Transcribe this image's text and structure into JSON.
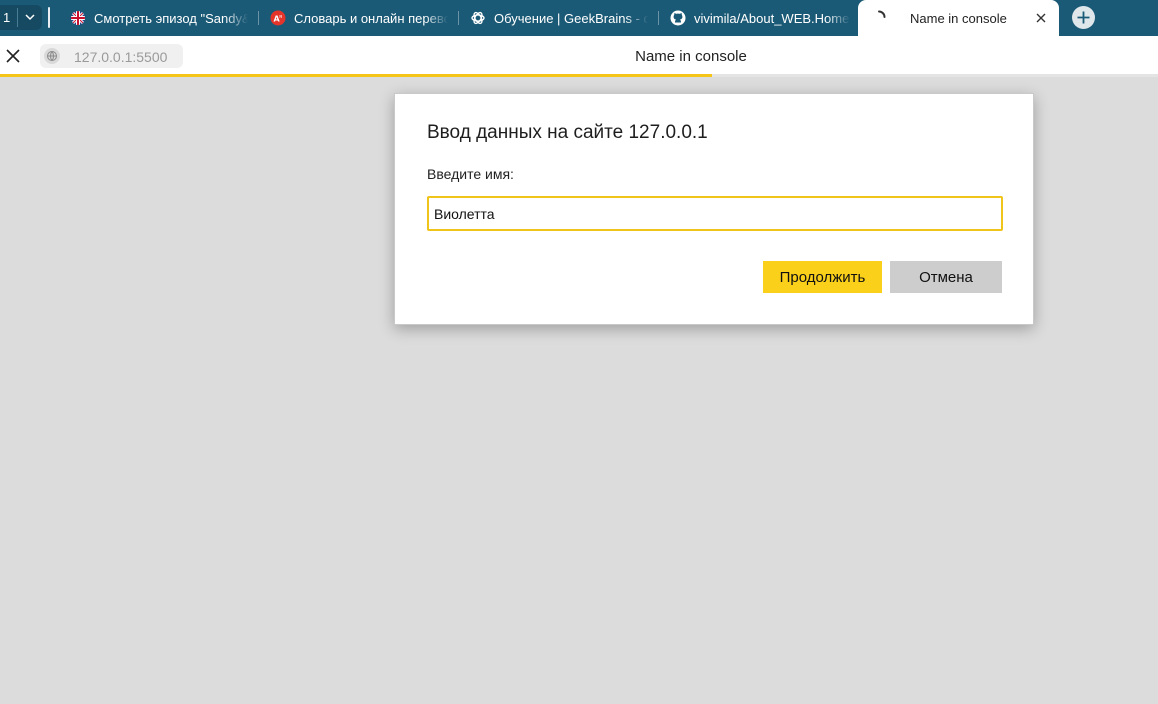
{
  "window": {
    "tab_count": "1",
    "tabs": [
      {
        "title": "Смотреть эпизод \"Sandy&",
        "icon": "uk-flag-icon"
      },
      {
        "title": "Словарь и онлайн перевод",
        "icon": "translator-icon"
      },
      {
        "title": "Обучение | GeekBrains - о",
        "icon": "openai-icon"
      },
      {
        "title": "vivimila/About_WEB.Home",
        "icon": "github-icon"
      }
    ],
    "active_tab": {
      "title": "Name in console",
      "icon": "loading-spinner-icon"
    }
  },
  "addressbar": {
    "url": "127.0.0.1:5500",
    "page_title": "Name in console",
    "load_progress": 0.615
  },
  "dialog": {
    "title": "Ввод данных на сайте 127.0.0.1",
    "label": "Введите имя:",
    "input_value": "Виолетта",
    "ok_label": "Продолжить",
    "cancel_label": "Отмена"
  },
  "colors": {
    "tabstrip": "#1b5a76",
    "accent_yellow": "#fbd01a",
    "page_background": "#dcdcdc"
  }
}
